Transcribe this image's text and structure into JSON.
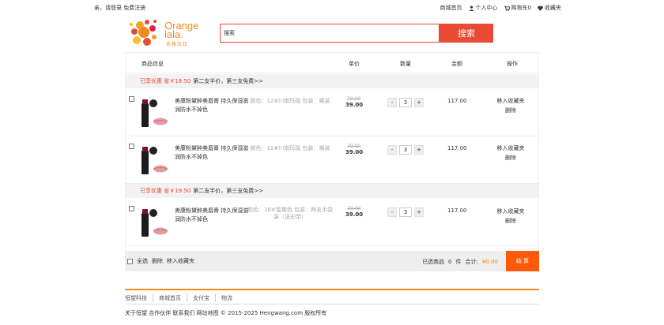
{
  "topbar": {
    "greeting": "亲，请登录",
    "register": "免费注册",
    "mall_home": "商城首页",
    "user_center": "个人中心",
    "cart": "购物车0",
    "favorites": "收藏夹"
  },
  "logo": {
    "line1": "Orange",
    "line2": "lala.",
    "sub": "优格拉拉"
  },
  "search": {
    "value": "搜索",
    "button": "搜索"
  },
  "table_headers": {
    "info": "商品信息",
    "price": "单价",
    "qty": "数量",
    "amount": "金额",
    "ops": "操作"
  },
  "promo": {
    "highlight": "已享优惠 省￥19.50",
    "text": "第二支半价，第三支免费>>"
  },
  "items": [
    {
      "title": "美康粉黛醉美唇膏 持久保湿滋润防水不掉色",
      "attrs": "颜色：12#川南玛瑙 包装：裸装",
      "old_price": "79.00",
      "price": "39.00",
      "qty": "3",
      "minus": "-",
      "plus": "+",
      "sum": "117.00",
      "op_fav": "移入收藏夹",
      "op_del": "删除"
    },
    {
      "title": "美康粉黛醉美唇膏 持久保湿滋润防水不掉色",
      "attrs": "颜色：12#川南玛瑙 包装：裸装",
      "old_price": "79.00",
      "price": "39.00",
      "qty": "3",
      "minus": "-",
      "plus": "+",
      "sum": "117.00",
      "op_fav": "移入收藏夹",
      "op_del": "删除"
    },
    {
      "title": "美康粉黛醉美唇膏 持久保湿滋润防水不掉色",
      "attrs": "颜色：10#蜜橘色 包装：两支手袋装（送彩带）",
      "old_price": "79.00",
      "price": "39.00",
      "qty": "3",
      "minus": "-",
      "plus": "+",
      "sum": "117.00",
      "op_fav": "移入收藏夹",
      "op_del": "删除"
    }
  ],
  "bottom_bar": {
    "select_all": "全选",
    "delete": "删除",
    "move_fav": "移入收藏夹",
    "selected_label": "已选商品",
    "selected_count": "0",
    "unit": "件",
    "total_label": "合计:",
    "total_value": "¥0.00",
    "checkout": "结 算"
  },
  "footer": {
    "links": [
      "恒望科技",
      "商城首页",
      "支付宝",
      "物流"
    ],
    "copyright": "关于恒望 合作伙伴 联系我们 网站地图 © 2015-2025 Hengwang.com 版权所有"
  },
  "colors": {
    "accent": "#e84a33",
    "orange": "#f08a1f",
    "checkout": "#ff5a0a"
  }
}
